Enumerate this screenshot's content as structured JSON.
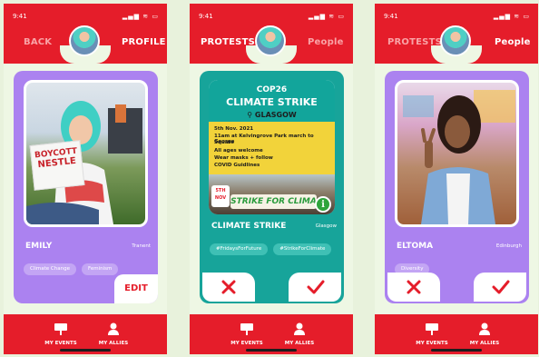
{
  "status": {
    "time": "9:41",
    "icons": "▂▄▆ ≋ ▭"
  },
  "colors": {
    "brand_red": "#e51d2a",
    "purple_card": "#ab82f0",
    "teal_card": "#17a49a",
    "background": "#e8f2dc"
  },
  "screens": [
    {
      "header": {
        "left_tab": "BACK",
        "right_tab": "PROFILE"
      },
      "card": {
        "name": "EMILY",
        "location": "Tranent",
        "tags": [
          "Climate Change",
          "Feminism"
        ],
        "edit_label": "EDIT"
      },
      "photo": {
        "sign_line1": "BOYCOTT",
        "sign_line2": "NESTLE"
      },
      "footer": {
        "events_label": "MY EVENTS",
        "allies_label": "MY ALLIES"
      }
    },
    {
      "header": {
        "left_tab": "PROTESTS",
        "right_tab": "People"
      },
      "poster": {
        "line1": "COP26",
        "line2": "CLIMATE STRIKE",
        "line3": "GLASGOW",
        "date": "5th Nov. 2021",
        "detail1": "11am at Kelvingrove Park march to George",
        "detail2": "Square",
        "detail3": "All ages welcome",
        "detail4": "Wear masks + follow",
        "detail5": "COVID Guidlines",
        "badge_line1": "5TH",
        "badge_line2": "NOV",
        "banner": "STRIKE FOR CLIMA",
        "info": "i"
      },
      "card": {
        "name": "CLIMATE STRIKE",
        "location": "Glasgow",
        "tags": [
          "#FridaysForFuture",
          "#StrikeForClimate"
        ]
      },
      "footer": {
        "events_label": "MY EVENTS",
        "allies_label": "MY ALLIES"
      }
    },
    {
      "header": {
        "left_tab": "PROTESTS",
        "right_tab": "People"
      },
      "card": {
        "name": "ELTOMA",
        "location": "Edinburgh",
        "tags": [
          "Diversity"
        ]
      },
      "footer": {
        "events_label": "MY EVENTS",
        "allies_label": "MY ALLIES"
      }
    }
  ]
}
